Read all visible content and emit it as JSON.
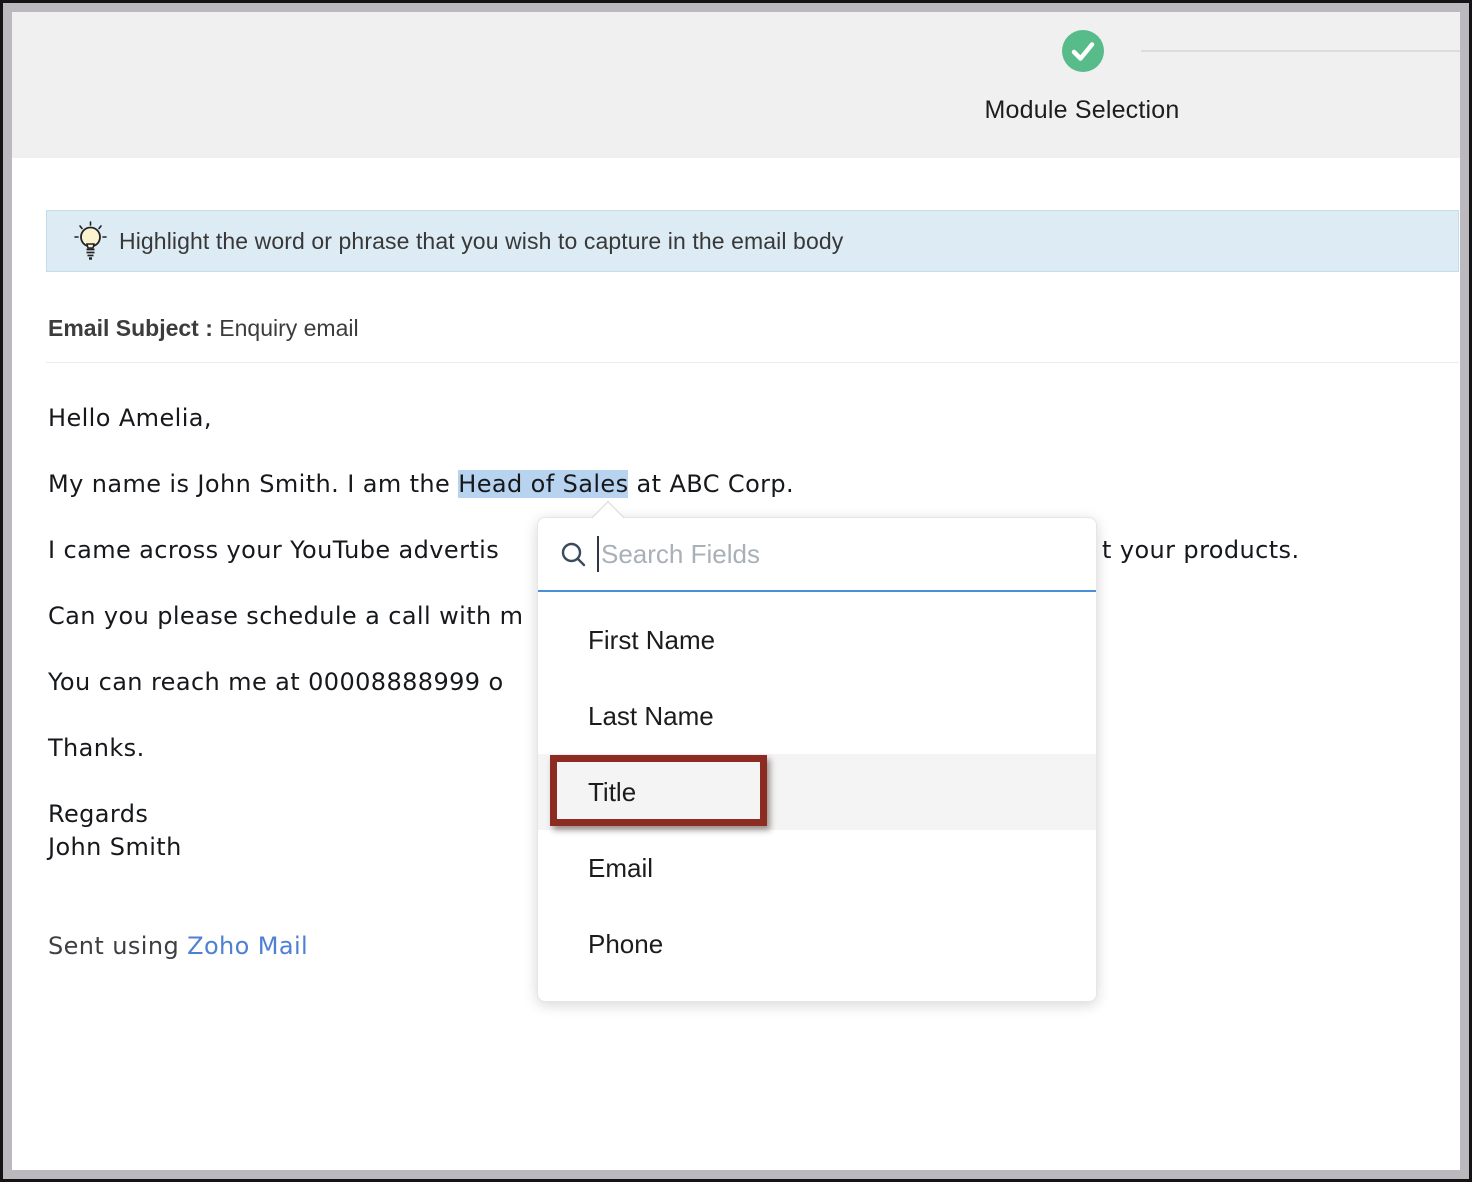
{
  "step_indicator": {
    "label": "Module Selection",
    "state": "completed",
    "accent_color": "#57bb8a"
  },
  "banner": {
    "icon": "lightbulb-icon",
    "text": "Highlight the word or phrase that you wish to capture in the email body",
    "background_color": "#dcebf4"
  },
  "subject": {
    "label": "Email Subject :",
    "value": "Enquiry email"
  },
  "email_body": {
    "greeting": "Hello Amelia,",
    "line2_before": "My name is John Smith. I am the ",
    "line2_highlight": "Head of Sales",
    "line2_after": " at ABC Corp.",
    "highlight_color": "#b7d3f0",
    "line3_left": "I came across your YouTube advertis",
    "line3_right": "t your products.",
    "line4_left": "Can you please schedule a call with m",
    "line5_left": "You can reach me at 00008888999 o",
    "thanks": "Thanks.",
    "regards": "Regards",
    "signature": "John Smith",
    "footer_prefix": "Sent using ",
    "footer_link": "Zoho Mail",
    "link_color": "#4e80d3"
  },
  "dropdown": {
    "search_placeholder": "Search Fields",
    "search_value": "",
    "underline_color": "#4a90d9",
    "items": [
      {
        "label": "First Name"
      },
      {
        "label": "Last Name"
      },
      {
        "label": "Title"
      },
      {
        "label": "Email"
      },
      {
        "label": "Phone"
      }
    ],
    "highlighted_item": "Title",
    "annotation_color": "#8c2b21"
  }
}
